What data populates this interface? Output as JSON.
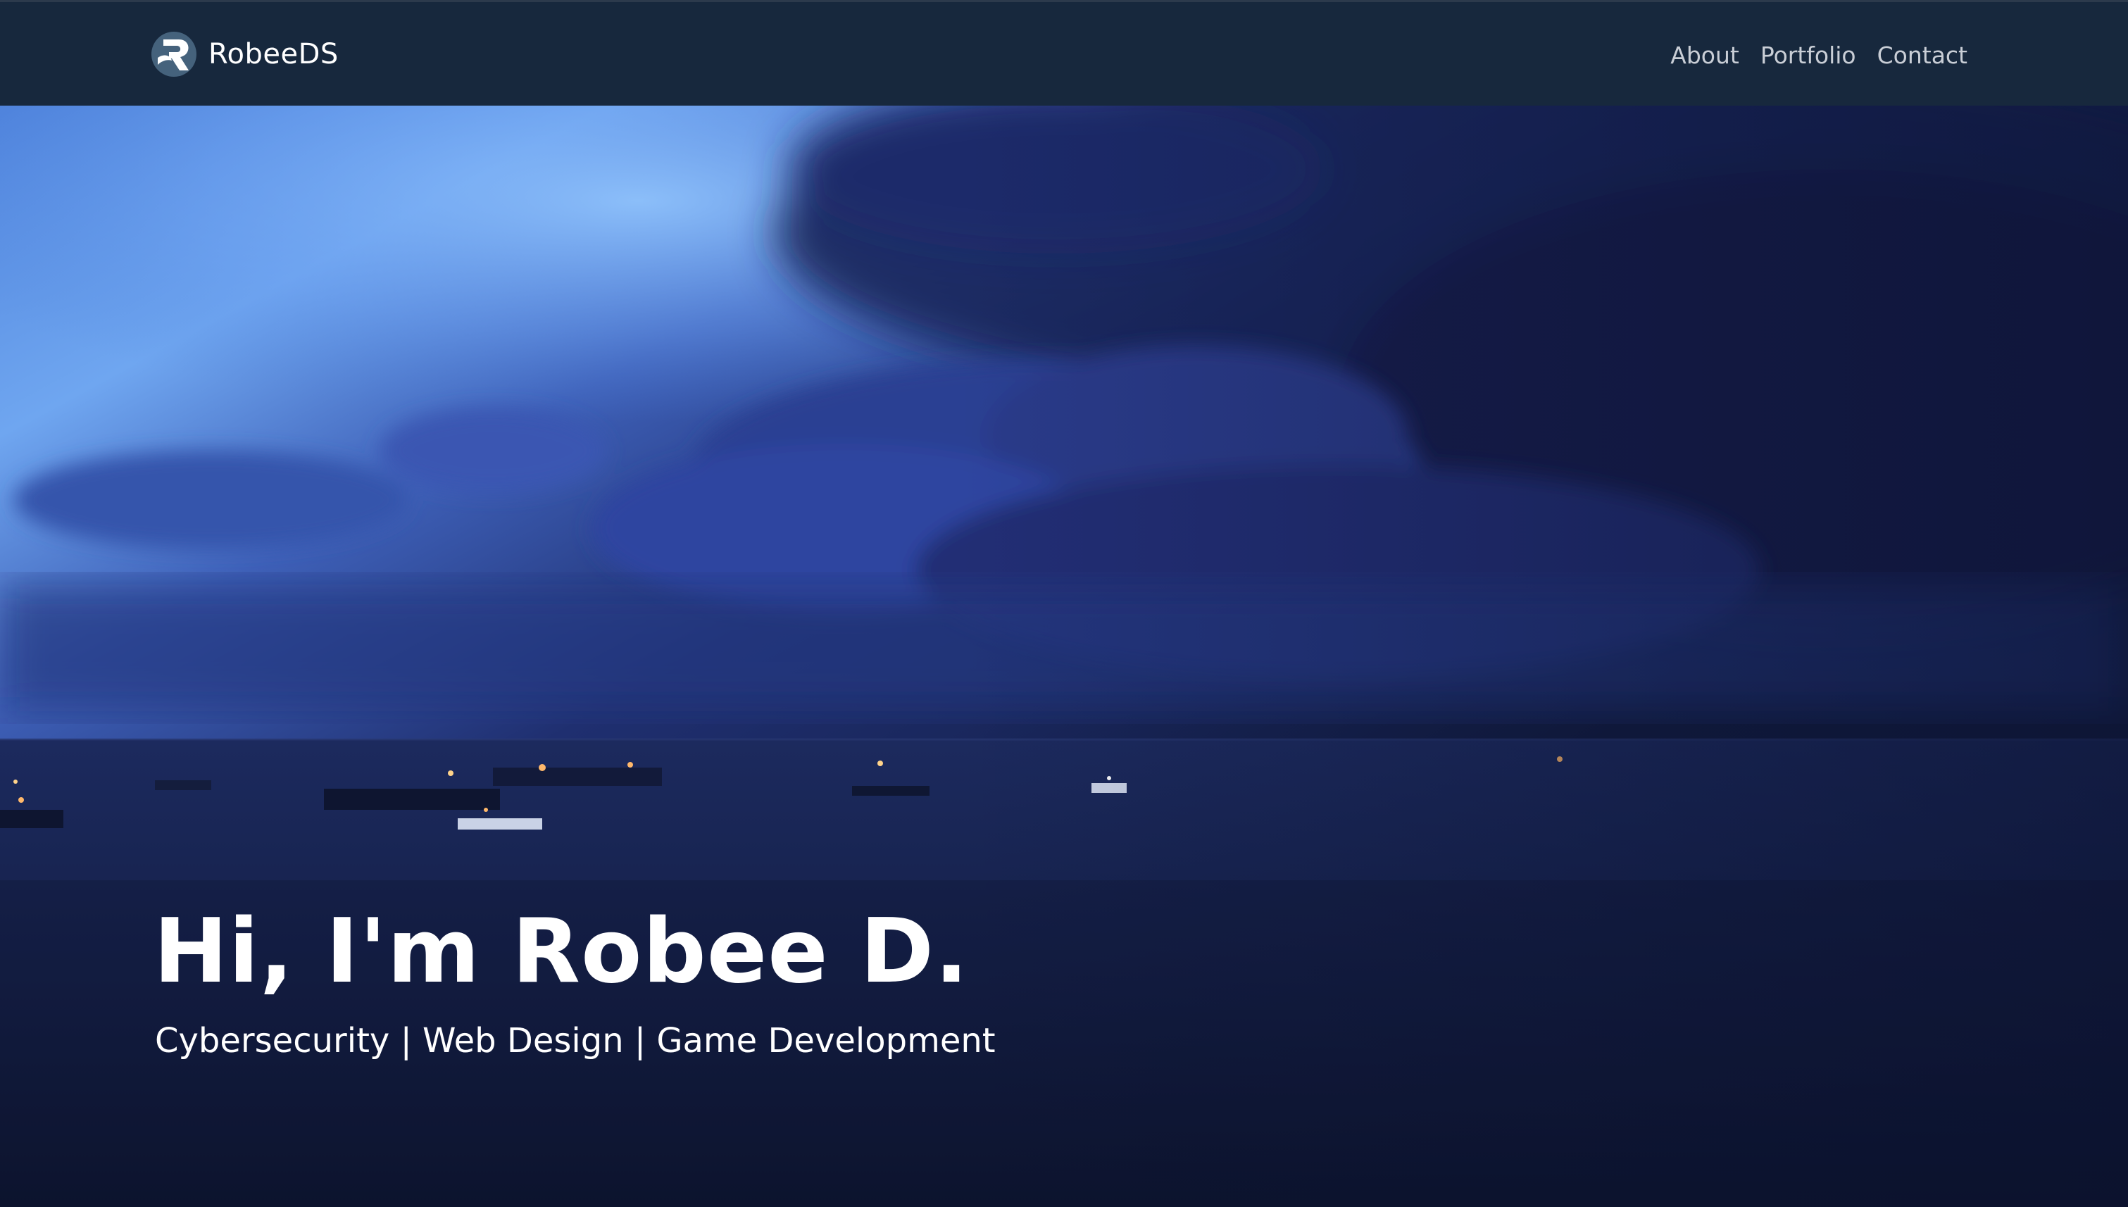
{
  "brand": {
    "name": "RobeeDS",
    "logo_icon": "robee-r-logo-icon"
  },
  "nav": {
    "items": [
      {
        "label": "About"
      },
      {
        "label": "Portfolio"
      },
      {
        "label": "Contact"
      }
    ]
  },
  "hero": {
    "title": "Hi, I'm Robee D.",
    "subtitle": "Cybersecurity | Web Design | Game Development",
    "background": "stormy-sea-dusk-photo"
  },
  "colors": {
    "navbar_bg": "#17283d",
    "nav_text": "#c9ced6",
    "hero_text": "#ffffff",
    "sky_light": "#7fb3f2",
    "sea_dark": "#0f1a33"
  }
}
